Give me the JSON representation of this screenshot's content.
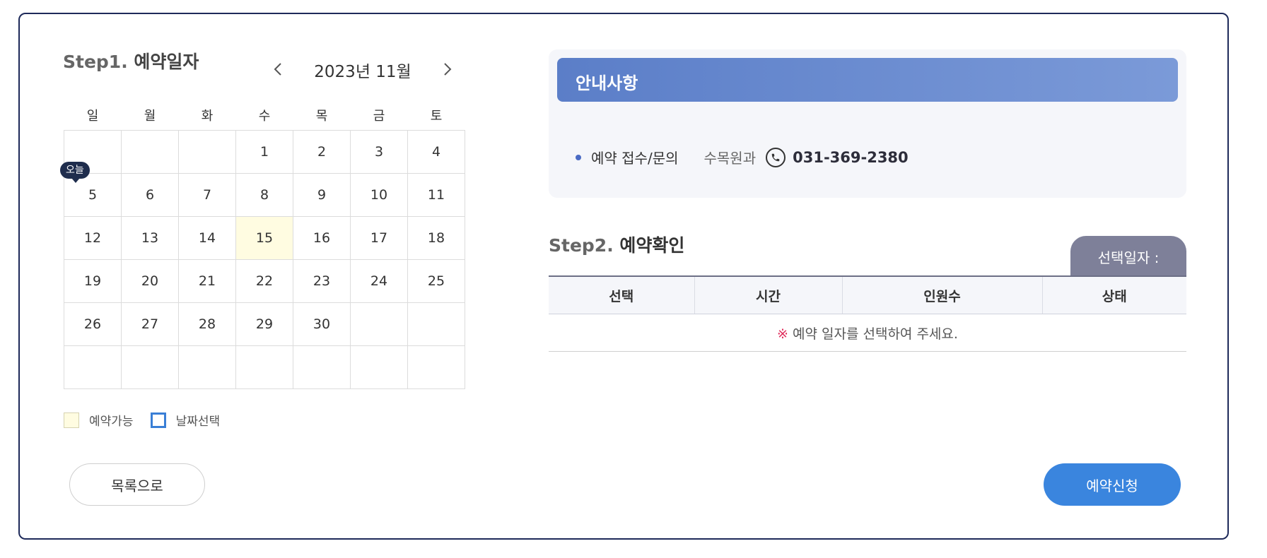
{
  "step1": {
    "num": "Step1.",
    "title": "예약일자"
  },
  "calendar": {
    "month_label": "2023년 11월",
    "weekdays": [
      "일",
      "월",
      "화",
      "수",
      "목",
      "금",
      "토"
    ],
    "weeks": [
      [
        "",
        "",
        "",
        "1",
        "2",
        "3",
        "4"
      ],
      [
        "5",
        "6",
        "7",
        "8",
        "9",
        "10",
        "11"
      ],
      [
        "12",
        "13",
        "14",
        "15",
        "16",
        "17",
        "18"
      ],
      [
        "19",
        "20",
        "21",
        "22",
        "23",
        "24",
        "25"
      ],
      [
        "26",
        "27",
        "28",
        "29",
        "30",
        "",
        ""
      ],
      [
        "",
        "",
        "",
        "",
        "",
        "",
        ""
      ]
    ],
    "today": "5",
    "today_label": "오늘",
    "available_dates": [
      "15"
    ]
  },
  "legend": {
    "available": "예약가능",
    "selected": "날짜선택"
  },
  "buttons": {
    "list": "목록으로",
    "apply": "예약신청"
  },
  "notice": {
    "title": "안내사항",
    "item_label": "예약 접수/문의",
    "dept": "수목원과",
    "phone": "031-369-2380"
  },
  "step2": {
    "num": "Step2.",
    "title": "예약확인",
    "selected_date_label": "선택일자 :"
  },
  "reservation_table": {
    "headers": [
      "선택",
      "시간",
      "인원수",
      "상태"
    ],
    "empty_mark": "※",
    "empty_message": " 예약 일자를 선택하여 주세요."
  },
  "colors": {
    "accent": "#3a85de",
    "available_bg": "#fffce1",
    "notice_header": "#5b7ec8",
    "frame": "#1e2a5a"
  },
  "icons": {
    "prev": "chevron-left-icon",
    "next": "chevron-right-icon",
    "phone": "phone-icon"
  }
}
